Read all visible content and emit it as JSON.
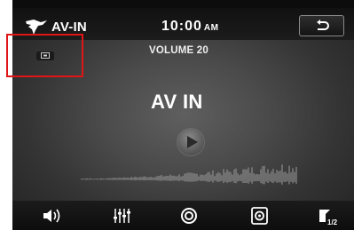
{
  "header": {
    "source": "AV-IN",
    "time": "10:00",
    "ampm": "AM"
  },
  "volume_label": "VOLUME 20",
  "main": {
    "title": "AV IN"
  },
  "icons": {
    "brand": "eagle-logo-icon",
    "back": "back-arrow-icon",
    "screen": "screen-mode-icon",
    "play": "play-icon",
    "speaker": "speaker-icon",
    "equalizer": "equalizer-icon",
    "circle": "disc-icon",
    "radio": "radio-icon",
    "page": "page-icon"
  },
  "bottombar": {
    "page_indicator": "1/2"
  },
  "colors": {
    "highlight": "#e01616",
    "text": "#ffffff"
  }
}
